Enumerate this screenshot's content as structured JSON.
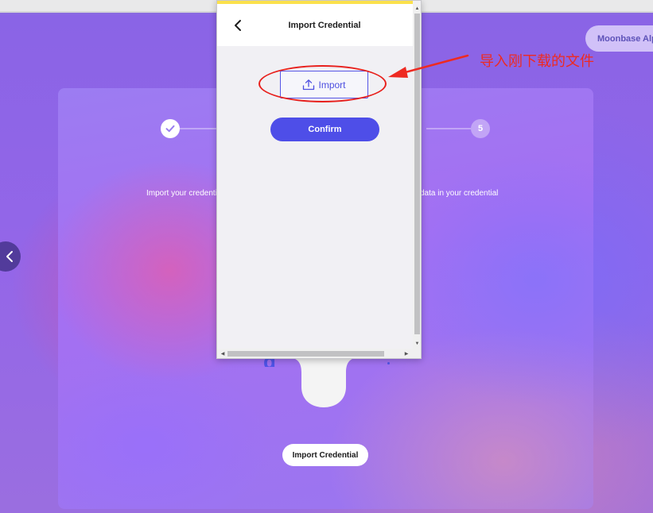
{
  "browser": {
    "network_label": "Moonbase Alpha"
  },
  "page": {
    "stepper": {
      "step_5_label": "5"
    },
    "left_desc": "Import your credential",
    "right_desc": "data in your credential",
    "import_credential_button": "Import Credential",
    "partial_title_fragment": "g"
  },
  "popup": {
    "title": "Import Credential",
    "import_button": "Import",
    "confirm_button": "Confirm",
    "accent_color": "#fbe14b",
    "primary_color": "#4e4ee8"
  },
  "annotation": {
    "text": "导入刚下载的文件",
    "color": "#ee2a22"
  }
}
